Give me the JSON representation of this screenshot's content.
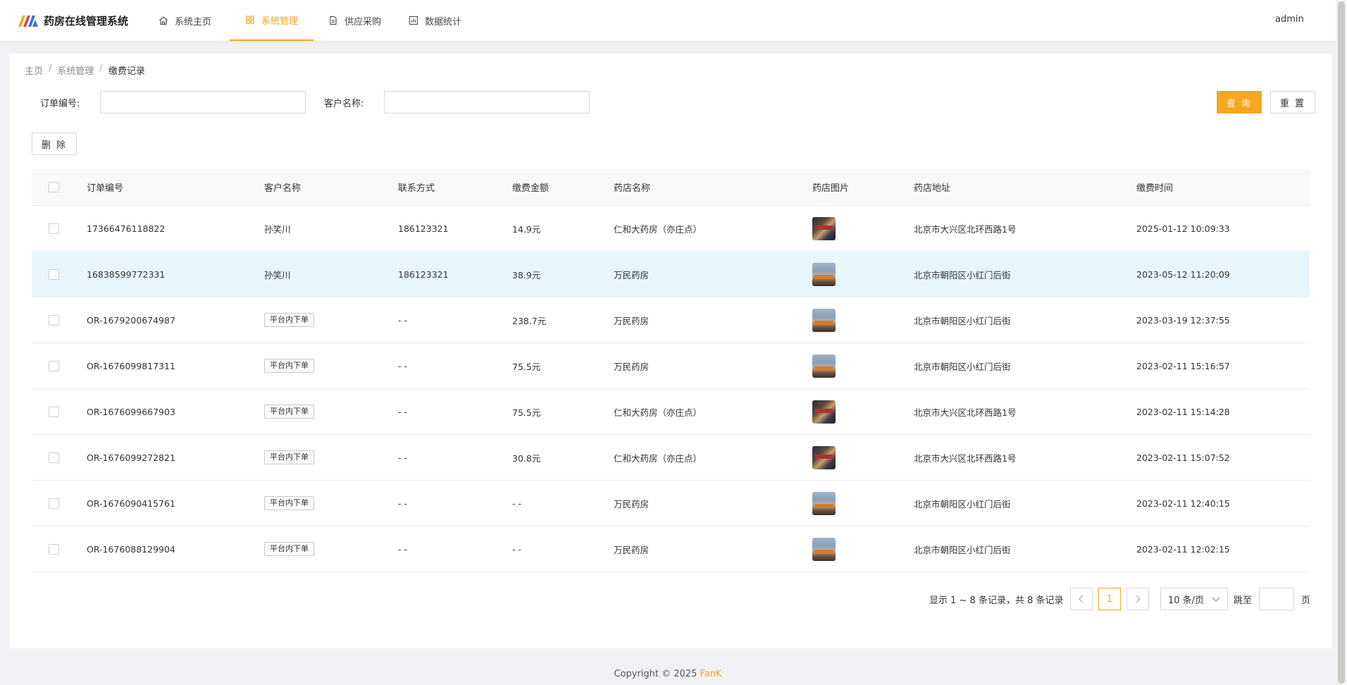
{
  "header": {
    "app_title": "药房在线管理系统",
    "nav": [
      {
        "label": "系统主页",
        "icon": "home-icon",
        "active": false
      },
      {
        "label": "系统管理",
        "icon": "grid-icon",
        "active": true
      },
      {
        "label": "供应采购",
        "icon": "document-icon",
        "active": false
      },
      {
        "label": "数据统计",
        "icon": "chart-icon",
        "active": false
      }
    ],
    "user": "admin"
  },
  "breadcrumb": [
    "主页",
    "系统管理",
    "缴费记录"
  ],
  "search": {
    "order_label": "订单编号:",
    "order_value": "",
    "customer_label": "客户名称:",
    "customer_value": "",
    "query_button": "查 询",
    "reset_button": "重 置"
  },
  "toolbar": {
    "delete_button": "删 除"
  },
  "table": {
    "columns": [
      "订单编号",
      "客户名称",
      "联系方式",
      "缴费金额",
      "药店名称",
      "药店图片",
      "药店地址",
      "缴费时间"
    ],
    "rows": [
      {
        "order": "17366476118822",
        "customer": "孙笑川",
        "customer_is_tag": false,
        "phone": "186123321",
        "amount": "14.9元",
        "store": "仁和大药房（亦庄点）",
        "image": "a",
        "address": "北京市大兴区北环西路1号",
        "time": "2025-01-12 10:09:33"
      },
      {
        "order": "16838599772331",
        "customer": "孙笑川",
        "customer_is_tag": false,
        "phone": "186123321",
        "amount": "38.9元",
        "store": "万民药房",
        "image": "b",
        "address": "北京市朝阳区小红门后街",
        "time": "2023-05-12 11:20:09"
      },
      {
        "order": "OR-1679200674987",
        "customer": "平台内下单",
        "customer_is_tag": true,
        "phone": "- -",
        "amount": "238.7元",
        "store": "万民药房",
        "image": "b",
        "address": "北京市朝阳区小红门后街",
        "time": "2023-03-19 12:37:55"
      },
      {
        "order": "OR-1676099817311",
        "customer": "平台内下单",
        "customer_is_tag": true,
        "phone": "- -",
        "amount": "75.5元",
        "store": "万民药房",
        "image": "b",
        "address": "北京市朝阳区小红门后街",
        "time": "2023-02-11 15:16:57"
      },
      {
        "order": "OR-1676099667903",
        "customer": "平台内下单",
        "customer_is_tag": true,
        "phone": "- -",
        "amount": "75.5元",
        "store": "仁和大药房（亦庄点）",
        "image": "a",
        "address": "北京市大兴区北环西路1号",
        "time": "2023-02-11 15:14:28"
      },
      {
        "order": "OR-1676099272821",
        "customer": "平台内下单",
        "customer_is_tag": true,
        "phone": "- -",
        "amount": "30.8元",
        "store": "仁和大药房（亦庄点）",
        "image": "a",
        "address": "北京市大兴区北环西路1号",
        "time": "2023-02-11 15:07:52"
      },
      {
        "order": "OR-1676090415761",
        "customer": "平台内下单",
        "customer_is_tag": true,
        "phone": "- -",
        "amount": "- -",
        "store": "万民药房",
        "image": "b",
        "address": "北京市朝阳区小红门后街",
        "time": "2023-02-11 12:40:15"
      },
      {
        "order": "OR-1676088129904",
        "customer": "平台内下单",
        "customer_is_tag": true,
        "phone": "- -",
        "amount": "- -",
        "store": "万民药房",
        "image": "b",
        "address": "北京市朝阳区小红门后街",
        "time": "2023-02-11 12:02:15"
      }
    ],
    "highlighted_row": 1
  },
  "pagination": {
    "summary": "显示 1 ~ 8 条记录，共 8 条记录",
    "current_page": "1",
    "page_size": "10 条/页",
    "jump_label": "跳至",
    "jump_value": "",
    "page_suffix": "页"
  },
  "footer": {
    "copyright": "Copyright © 2025 ",
    "brand": "FanK"
  },
  "colors": {
    "accent": "#f6a623",
    "highlight_row": "#e8f6fc"
  }
}
